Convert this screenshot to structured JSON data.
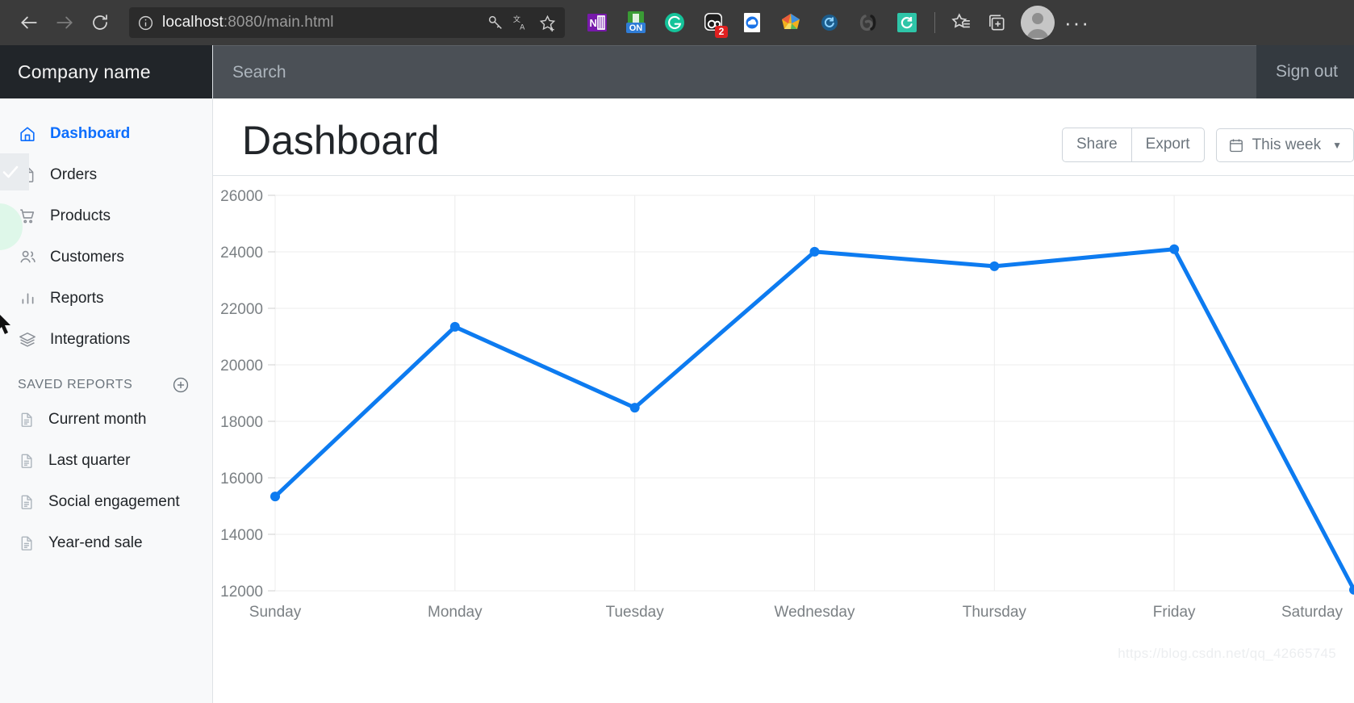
{
  "browser": {
    "back_icon": "arrow-left-icon",
    "forward_icon": "arrow-right-icon",
    "reload_icon": "reload-icon",
    "info_icon": "info-circle-icon",
    "url_host": "localhost",
    "url_rest": ":8080/main.html",
    "url_full": "localhost:8080/main.html",
    "password_icon": "key-icon",
    "translate_icon": "translate-icon",
    "favorite_icon": "star-add-icon",
    "extensions": [
      {
        "name": "onenote-extension-icon",
        "label": "N"
      },
      {
        "name": "onenote-clipper-extension-icon",
        "label": "ON"
      },
      {
        "name": "grammarly-extension-icon",
        "label": "G"
      },
      {
        "name": "toolbox-extension-icon",
        "label": "",
        "badge": "2"
      },
      {
        "name": "cloud-extension-icon",
        "label": ""
      },
      {
        "name": "colorpicker-extension-icon",
        "label": ""
      },
      {
        "name": "sync-extension-icon",
        "label": ""
      },
      {
        "name": "loop-extension-icon",
        "label": ""
      },
      {
        "name": "refresh-extension-icon",
        "label": ""
      }
    ],
    "collections_icon": "collections-icon",
    "favorites_bar_icon": "favorites-list-icon",
    "profile_icon": "profile-avatar-icon",
    "more_icon": "ellipsis-icon",
    "more_label": "···"
  },
  "sidebar": {
    "brand": "Company name",
    "nav": [
      {
        "label": "Dashboard",
        "icon": "home-icon",
        "active": true
      },
      {
        "label": "Orders",
        "icon": "file-icon",
        "active": false
      },
      {
        "label": "Products",
        "icon": "cart-icon",
        "active": false
      },
      {
        "label": "Customers",
        "icon": "people-icon",
        "active": false
      },
      {
        "label": "Reports",
        "icon": "bar-chart-icon",
        "active": false
      },
      {
        "label": "Integrations",
        "icon": "layers-icon",
        "active": false
      }
    ],
    "saved_reports_title": "SAVED REPORTS",
    "saved_add_icon": "plus-circle-icon",
    "saved_reports": [
      {
        "label": "Current month",
        "icon": "document-text-icon"
      },
      {
        "label": "Last quarter",
        "icon": "document-text-icon"
      },
      {
        "label": "Social engagement",
        "icon": "document-text-icon"
      },
      {
        "label": "Year-end sale",
        "icon": "document-text-icon"
      }
    ],
    "active_color": "#0d6efd"
  },
  "topbar": {
    "search_placeholder": "Search",
    "signout_label": "Sign out"
  },
  "page": {
    "title": "Dashboard",
    "share_label": "Share",
    "export_label": "Export",
    "daterange_label": "This week",
    "daterange_icon": "calendar-icon",
    "daterange_caret": "▼",
    "watermark": "https://blog.csdn.net/qq_42665745"
  },
  "chart_data": {
    "type": "line",
    "title": "",
    "xlabel": "",
    "ylabel": "",
    "categories": [
      "Sunday",
      "Monday",
      "Tuesday",
      "Wednesday",
      "Thursday",
      "Friday",
      "Saturday"
    ],
    "values": [
      15339,
      21345,
      18483,
      24003,
      23489,
      24092,
      12034
    ],
    "ylim": [
      12000,
      26000
    ],
    "yticks": [
      12000,
      14000,
      16000,
      18000,
      20000,
      22000,
      24000,
      26000
    ],
    "ytick_labels": [
      "12000",
      "14000",
      "16000",
      "18000",
      "20000",
      "22000",
      "24000",
      "26000"
    ],
    "series": [
      {
        "name": "",
        "values": [
          15339,
          21345,
          18483,
          24003,
          23489,
          24092,
          12034
        ]
      }
    ],
    "line_color": "#0d7bf0",
    "point_color": "#0d7bf0",
    "line_width": 5,
    "point_radius": 6,
    "grid": true,
    "legend": false
  }
}
